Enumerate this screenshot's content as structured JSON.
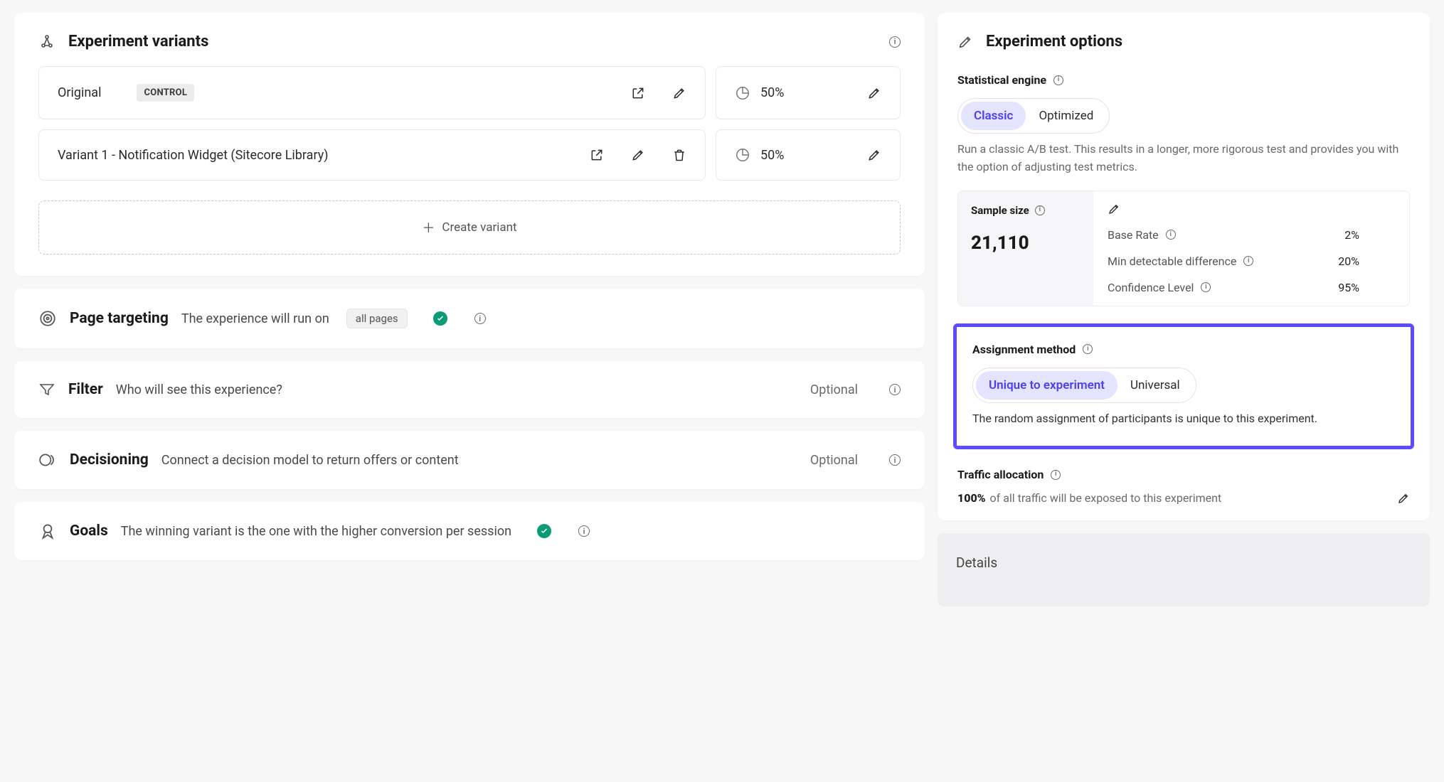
{
  "variants": {
    "heading": "Experiment variants",
    "items": [
      {
        "name": "Original",
        "badge": "CONTROL",
        "split": "50%"
      },
      {
        "name": "Variant 1 - Notification Widget (Sitecore Library)",
        "split": "50%"
      }
    ],
    "create_label": "Create variant"
  },
  "page_targeting": {
    "heading": "Page targeting",
    "desc": "The experience will run on",
    "pill": "all pages"
  },
  "filter": {
    "heading": "Filter",
    "desc": "Who will see this experience?",
    "optional": "Optional"
  },
  "decisioning": {
    "heading": "Decisioning",
    "desc": "Connect a decision model to return offers or content",
    "optional": "Optional"
  },
  "goals": {
    "heading": "Goals",
    "desc": "The winning variant is the one with the higher conversion per session"
  },
  "options": {
    "heading": "Experiment options",
    "engine": {
      "label": "Statistical engine",
      "segments": [
        "Classic",
        "Optimized"
      ],
      "active": "Classic",
      "desc": "Run a classic A/B test. This results in a longer, more rigorous test and provides you with the option of adjusting test metrics."
    },
    "sample": {
      "label": "Sample size",
      "value": "21,110",
      "rows": [
        {
          "label": "Base Rate",
          "value": "2%"
        },
        {
          "label": "Min detectable difference",
          "value": "20%"
        },
        {
          "label": "Confidence Level",
          "value": "95%"
        }
      ]
    },
    "assignment": {
      "label": "Assignment method",
      "segments": [
        "Unique to experiment",
        "Universal"
      ],
      "active": "Unique to experiment",
      "desc": "The random assignment of participants is unique to this experiment."
    },
    "traffic": {
      "label": "Traffic allocation",
      "pct": "100%",
      "rest": " of all traffic will be exposed to this experiment"
    }
  },
  "details": {
    "heading": "Details"
  }
}
